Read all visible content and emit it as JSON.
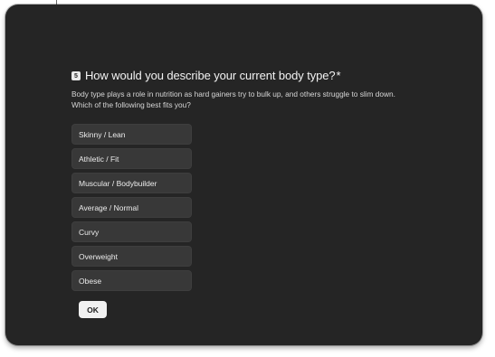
{
  "question": {
    "number": "5",
    "title": "How would you describe your current body type?",
    "required_marker": "*",
    "description": "Body type plays a role in nutrition as hard gainers try to bulk up, and others struggle to slim down. Which of the following best fits you?",
    "options": [
      {
        "label": "Skinny / Lean"
      },
      {
        "label": "Athletic / Fit"
      },
      {
        "label": "Muscular / Bodybuilder"
      },
      {
        "label": "Average / Normal"
      },
      {
        "label": "Curvy"
      },
      {
        "label": "Overweight"
      },
      {
        "label": "Obese"
      }
    ]
  },
  "actions": {
    "ok_label": "OK"
  },
  "colors": {
    "background": "#252525",
    "option_bg": "#383838",
    "button_bg": "#f1f1f1",
    "text": "#f2f2f2"
  }
}
